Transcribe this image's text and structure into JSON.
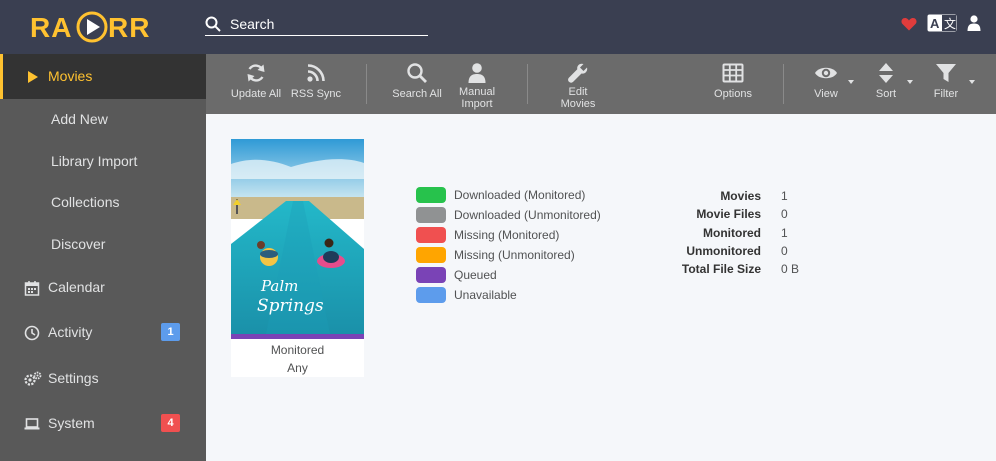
{
  "app": {
    "logo_text": "RADARR"
  },
  "header": {
    "search_placeholder": "Search",
    "icons": [
      "heart-icon",
      "translate-icon",
      "user-icon"
    ]
  },
  "sidebar": {
    "items": [
      {
        "label": "Movies",
        "icon": "play-icon",
        "active": true
      },
      {
        "label": "Add New"
      },
      {
        "label": "Library Import"
      },
      {
        "label": "Collections"
      },
      {
        "label": "Discover"
      },
      {
        "label": "Calendar",
        "icon": "calendar-icon"
      },
      {
        "label": "Activity",
        "icon": "clock-icon",
        "badge": "1"
      },
      {
        "label": "Settings",
        "icon": "gears-icon"
      },
      {
        "label": "System",
        "icon": "laptop-icon",
        "badge": "4"
      }
    ]
  },
  "toolbar": {
    "update_all": "Update All",
    "rss_sync": "RSS Sync",
    "search_all": "Search All",
    "manual_import_1": "Manual",
    "manual_import_2": "Import",
    "edit_movies_1": "Edit",
    "edit_movies_2": "Movies",
    "options": "Options",
    "view": "View",
    "sort": "Sort",
    "filter": "Filter"
  },
  "movie_card": {
    "poster_title_line1": "Palm",
    "poster_title_line2": "Springs",
    "status": "Monitored",
    "quality_profile": "Any"
  },
  "legend": [
    {
      "label": "Downloaded (Monitored)",
      "color": "#27c24c"
    },
    {
      "label": "Downloaded (Unmonitored)",
      "color": "#909293"
    },
    {
      "label": "Missing (Monitored)",
      "color": "#f05050"
    },
    {
      "label": "Missing (Unmonitored)",
      "color": "#ffa500"
    },
    {
      "label": "Queued",
      "color": "#7a43b6"
    },
    {
      "label": "Unavailable",
      "color": "#5d9cec"
    }
  ],
  "stats": [
    {
      "label": "Movies",
      "value": "1"
    },
    {
      "label": "Movie Files",
      "value": "0"
    },
    {
      "label": "Monitored",
      "value": "1"
    },
    {
      "label": "Unmonitored",
      "value": "0"
    },
    {
      "label": "Total File Size",
      "value": "0 B"
    }
  ],
  "colors": {
    "accent": "#ffc230",
    "header_bg": "#3a3f51",
    "sidebar_bg": "#595959",
    "toolbar_bg": "#6b6b6b",
    "badge_info": "#5d9cec",
    "badge_danger": "#f05050",
    "heart": "#e03c3c"
  }
}
